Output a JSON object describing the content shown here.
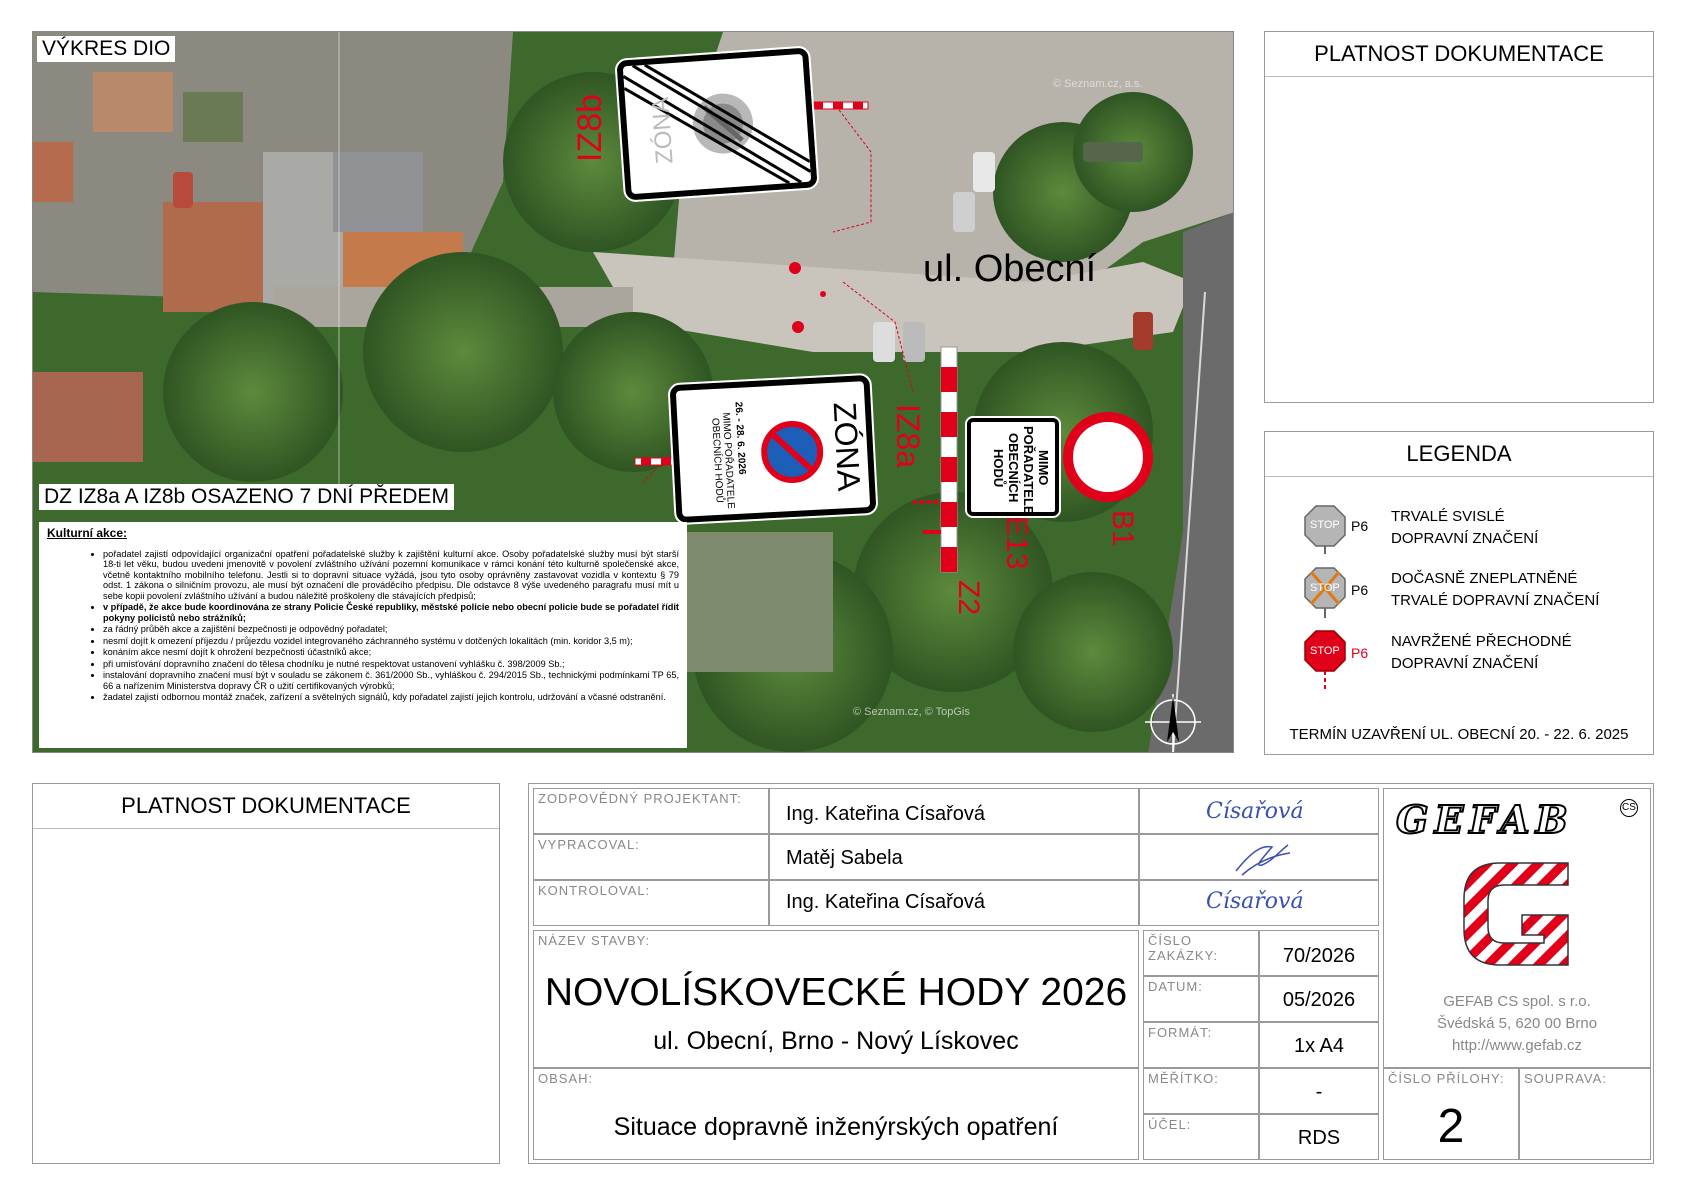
{
  "map": {
    "title": "VÝKRES DIO",
    "street": "ul. Obecní",
    "note_label": "DZ IZ8a A IZ8b OSAZENO 7 DNÍ PŘEDEM",
    "watermark_1": "© Seznam.cz, a.s.",
    "watermark_2": "© Seznam.cz, © TopGis",
    "signs": {
      "iz8b_code": "IZ8b",
      "iz8b_word": "ZÓNA",
      "iz8a_code": "IZ8a",
      "iz8a_word": "ZÓNA",
      "iz8a_dates": "26. - 28. 6. 2026",
      "iz8a_text": "MIMO POŘADATELE OBECNÍCH HODŮ",
      "e13_code": "E13",
      "e13_text": "MIMO POŘADATELE OBECNÍCH HODŮ",
      "b1_code": "B1",
      "z2_code": "Z2"
    },
    "notes": {
      "heading": "Kulturní akce:",
      "items": [
        {
          "text": "pořadatel zajistí odpovídající organizační opatření pořadatelské služby k zajištění kulturní akce. Osoby pořadatelské služby musí být starší 18-ti let věku, budou uvedeni jmenovitě v povolení zvláštního užívání pozemní komunikace v rámci konání této kulturně společenské akce, včetně kontaktního mobilního telefonu. Jestli si to dopravní situace vyžádá, jsou tyto osoby oprávněny zastavovat vozidla v kontextu § 79 odst. 1 zákona o silničním provozu, ale musí být označení dle prováděcího předpisu. Dle odstavce 8 výše uvedeného paragrafu musí mít u sebe kopii povolení zvláštního užívání a budou náležitě proškoleny dle stávajících předpisů;",
          "bold": false
        },
        {
          "text": "v případě, že akce bude koordinována ze strany Policie České republiky, městské policie nebo obecní policie bude se pořadatel řídit pokyny policistů nebo strážníků;",
          "bold": true
        },
        {
          "text": "za řádný průběh akce a zajištění bezpečnosti je odpovědný pořadatel;",
          "bold": false
        },
        {
          "text": "nesmí dojít k omezení příjezdu / průjezdu vozidel integrovaného záchranného systému v dotčených lokalitách (min. koridor 3,5 m);",
          "bold": false
        },
        {
          "text": "konáním akce nesmí dojít k ohrožení bezpečnosti účastníků akce;",
          "bold": false
        },
        {
          "text": "při umisťování dopravního značení do tělesa chodníku je nutné respektovat ustanovení vyhlášku č. 398/2009 Sb.;",
          "bold": false
        },
        {
          "text": "instalování dopravního značení musí být v souladu se zákonem č. 361/2000 Sb., vyhláškou č. 294/2015 Sb., technickými podmínkami TP 65, 66 a nařízením Ministerstva dopravy ČR o užití certifikovaných výrobků;",
          "bold": false
        },
        {
          "text": "žadatel zajistí odbornou montáž značek, zařízení a světelných signálů, kdy pořadatel zajistí jejich kontrolu, udržování a včasné odstranění.",
          "bold": false
        }
      ]
    }
  },
  "platnost_top": {
    "title": "PLATNOST DOKUMENTACE"
  },
  "platnost_bottom": {
    "title": "PLATNOST DOKUMENTACE"
  },
  "legend": {
    "title": "LEGENDA",
    "stop_text": "STOP",
    "p6": "P6",
    "items": [
      {
        "line1": "TRVALÉ SVISLÉ",
        "line2": "DOPRAVNÍ ZNAČENÍ"
      },
      {
        "line1": "DOČASNĚ ZNEPLATNĚNÉ",
        "line2": "TRVALÉ DOPRAVNÍ ZNAČENÍ"
      },
      {
        "line1": "NAVRŽENÉ PŘECHODNÉ",
        "line2": "DOPRAVNÍ ZNAČENÍ"
      }
    ],
    "closure": "TERMÍN UZAVŘENÍ UL. OBECNÍ 20. - 22. 6. 2025"
  },
  "titleblock": {
    "projektant_label": "ZODPOVĚDNÝ PROJEKTANT:",
    "projektant": "Ing. Kateřina Císařová",
    "vypracoval_label": "VYPRACOVAL:",
    "vypracoval": "Matěj Sabela",
    "kontroloval_label": "KONTROLOVAL:",
    "kontroloval": "Ing. Kateřina Císařová",
    "stavba_label": "NÁZEV STAVBY:",
    "stavba": "NOVOLÍSKOVECKÉ HODY 2026",
    "stavba_sub": "ul. Obecní, Brno - Nový Lískovec",
    "obsah_label": "OBSAH:",
    "obsah": "Situace dopravně inženýrských opatření",
    "zakazka_label": "ČÍSLO ZAKÁZKY:",
    "zakazka": "70/2026",
    "datum_label": "DATUM:",
    "datum": "05/2026",
    "format_label": "FORMÁT:",
    "format": "1x A4",
    "meritko_label": "MĚŘÍTKO:",
    "meritko": "-",
    "ucel_label": "ÚČEL:",
    "ucel": "RDS",
    "priloha_label": "ČÍSLO PŘÍLOHY:",
    "priloha": "2",
    "souprava_label": "SOUPRAVA:",
    "company_logo": "GEFAB",
    "company_logo_sup": "CS",
    "company_name": "GEFAB CS spol. s r.o.",
    "company_addr": "Švédská 5, 620 00 Brno",
    "company_web": "http://www.gefab.cz",
    "signature_1": "Císařová",
    "signature_3": "Císařová"
  },
  "colors": {
    "red": "#e0001a",
    "grey_border": "#9a9a9a",
    "map_green": "#3f6b2c"
  }
}
